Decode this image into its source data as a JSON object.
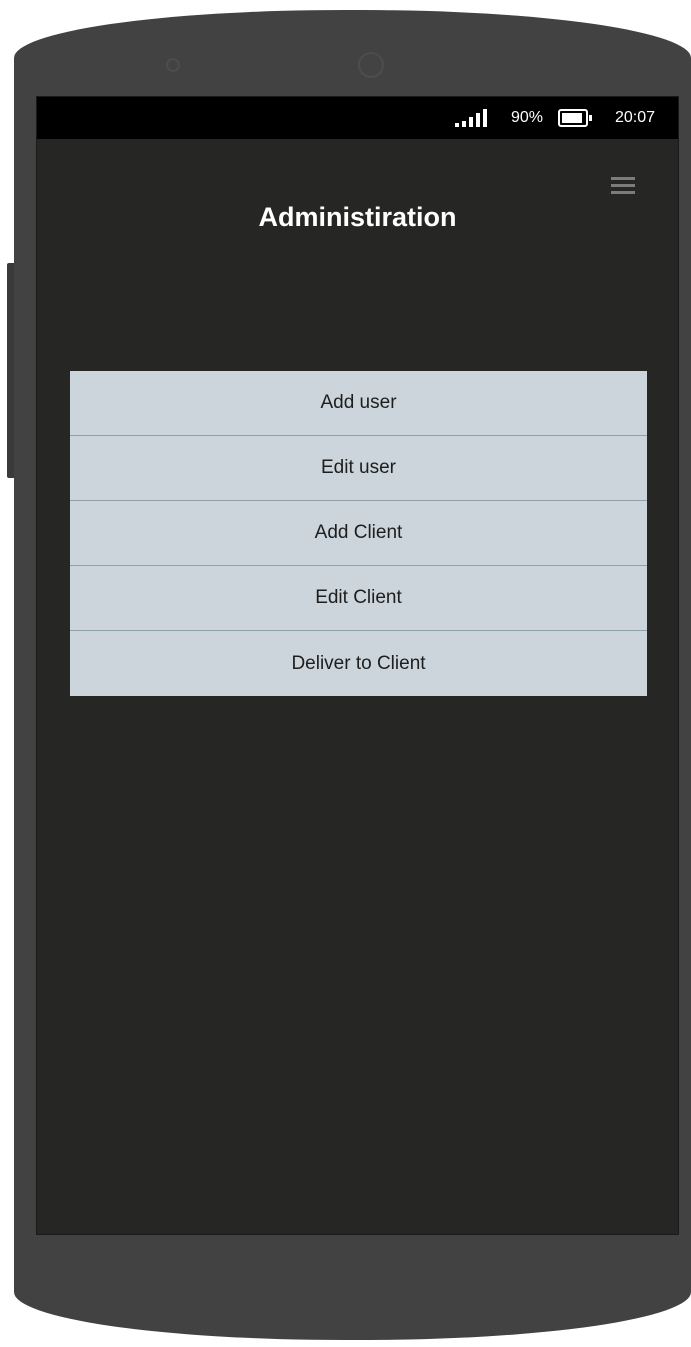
{
  "status_bar": {
    "battery_percent_label": "90%",
    "battery_level": 0.9,
    "time": "20:07",
    "signal_bars": 5
  },
  "header": {
    "title": "Administiration",
    "menu_icon": "hamburger-menu-icon"
  },
  "menu": {
    "items": [
      {
        "label": "Add user"
      },
      {
        "label": "Edit user"
      },
      {
        "label": "Add Client"
      },
      {
        "label": "Edit Client"
      },
      {
        "label": "Deliver to Client"
      }
    ]
  },
  "colors": {
    "screen_background": "#262624",
    "status_bar_background": "#000000",
    "menu_item_background": "#cbd5db",
    "menu_divider": "#8fa1ab",
    "device_frame": "#424242"
  }
}
